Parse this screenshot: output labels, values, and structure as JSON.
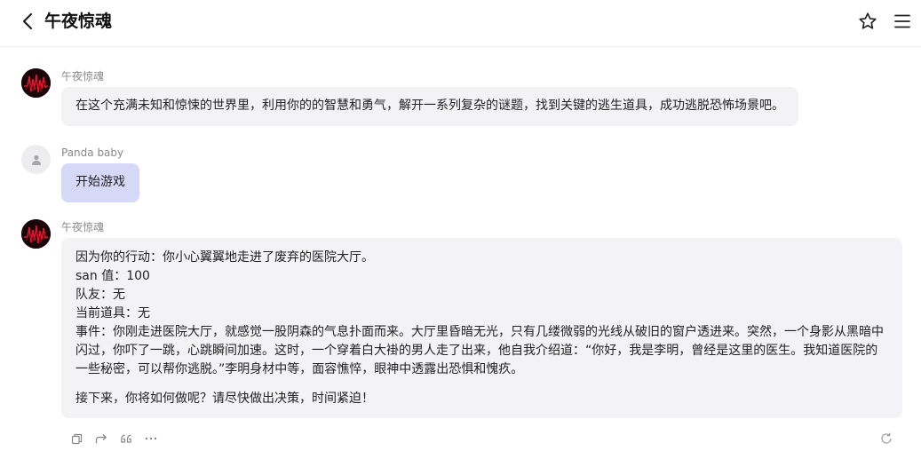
{
  "header": {
    "title": "午夜惊魂",
    "back_icon": "chevron-left-icon",
    "star_icon": "star-icon",
    "menu_icon": "hamburger-menu-icon"
  },
  "messages": [
    {
      "sender": "午夜惊魂",
      "role": "bot",
      "text": "在这个充满未知和惊悚的世界里，利用你的的智慧和勇气，解开一系列复杂的谜题，找到关键的逃生道具，成功逃脱恐怖场景吧。"
    },
    {
      "sender": "Panda baby",
      "role": "user",
      "text": "开始游戏"
    },
    {
      "sender": "午夜惊魂",
      "role": "bot",
      "lines": [
        "因为你的行动：你小心翼翼地走进了废弃的医院大厅。",
        "san 值：100",
        "队友：无",
        "当前道具：无",
        "事件：你刚走进医院大厅，就感觉一股阴森的气息扑面而来。大厅里昏暗无光，只有几缕微弱的光线从破旧的窗户透进来。突然，一个身影从黑暗中",
        "闪过，你吓了一跳，心跳瞬间加速。这时，一个穿着白大褂的男人走了出来，他自我介绍道：“你好，我是李明，曾经是这里的医生。我知道医院的",
        "一些秘密，可以帮你逃脱。”李明身材中等，面容憔悴，眼神中透露出恐惧和愧疚。"
      ],
      "closing": "接下来，你将如何做呢？请尽快做出决策，时间紧迫！"
    }
  ],
  "action_icons": [
    "copy-icon",
    "share-icon",
    "quote-icon",
    "more-icon",
    "refresh-icon"
  ],
  "colors": {
    "bot_bubble": "#f3f3f5",
    "user_bubble": "#d6d8f8",
    "avatar_accent": "#e0182e"
  }
}
